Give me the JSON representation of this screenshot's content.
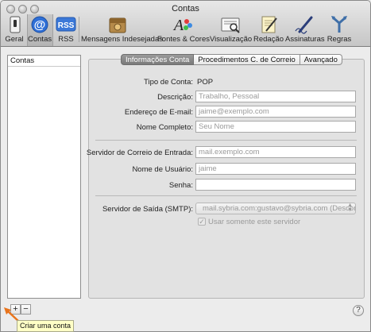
{
  "window": {
    "title": "Contas"
  },
  "toolbar": {
    "items": [
      {
        "label": "Geral",
        "icon": "switch-icon"
      },
      {
        "label": "Contas",
        "icon": "at-sign-icon"
      },
      {
        "label": "RSS",
        "icon": "rss-icon"
      },
      {
        "label": "Mensagens Indesejadas",
        "icon": "junk-mail-icon"
      },
      {
        "label": "Fontes & Cores",
        "icon": "fonts-colors-icon"
      },
      {
        "label": "Visualização",
        "icon": "viewing-icon"
      },
      {
        "label": "Redação",
        "icon": "composing-icon"
      },
      {
        "label": "Assinaturas",
        "icon": "signature-pen-icon"
      },
      {
        "label": "Regras",
        "icon": "rules-icon"
      }
    ],
    "selected": "Contas"
  },
  "accounts": {
    "header": "Contas",
    "add_label": "+",
    "remove_label": "−",
    "tooltip": "Criar uma conta",
    "help_label": "?"
  },
  "tabs": [
    {
      "label": "Informações Conta",
      "active": true
    },
    {
      "label": "Procedimentos C. de Correio",
      "active": false
    },
    {
      "label": "Avançado",
      "active": false
    }
  ],
  "form": {
    "account_type_label": "Tipo de Conta:",
    "account_type_value": "POP",
    "description_label": "Descrição:",
    "description_placeholder": "Trabalho, Pessoal",
    "email_label": "Endereço de E-mail:",
    "email_placeholder": "jaime@exemplo.com",
    "fullname_label": "Nome Completo:",
    "fullname_placeholder": "Seu Nome",
    "incoming_label": "Servidor de Correio de Entrada:",
    "incoming_placeholder": "mail.exemplo.com",
    "username_label": "Nome de Usuário:",
    "username_placeholder": "jaime",
    "password_label": "Senha:",
    "password_value": "",
    "smtp_label": "Servidor de Saída (SMTP):",
    "smtp_value": "mail.sybria.com:gustavo@sybria.com (Desconectado)",
    "only_server_label": "Usar somente este servidor",
    "only_server_checked": true
  },
  "colors": {
    "tooltip_bg": "#ffffc6",
    "arrow": "#e8741c",
    "active_tab": "#7f7f7f"
  }
}
